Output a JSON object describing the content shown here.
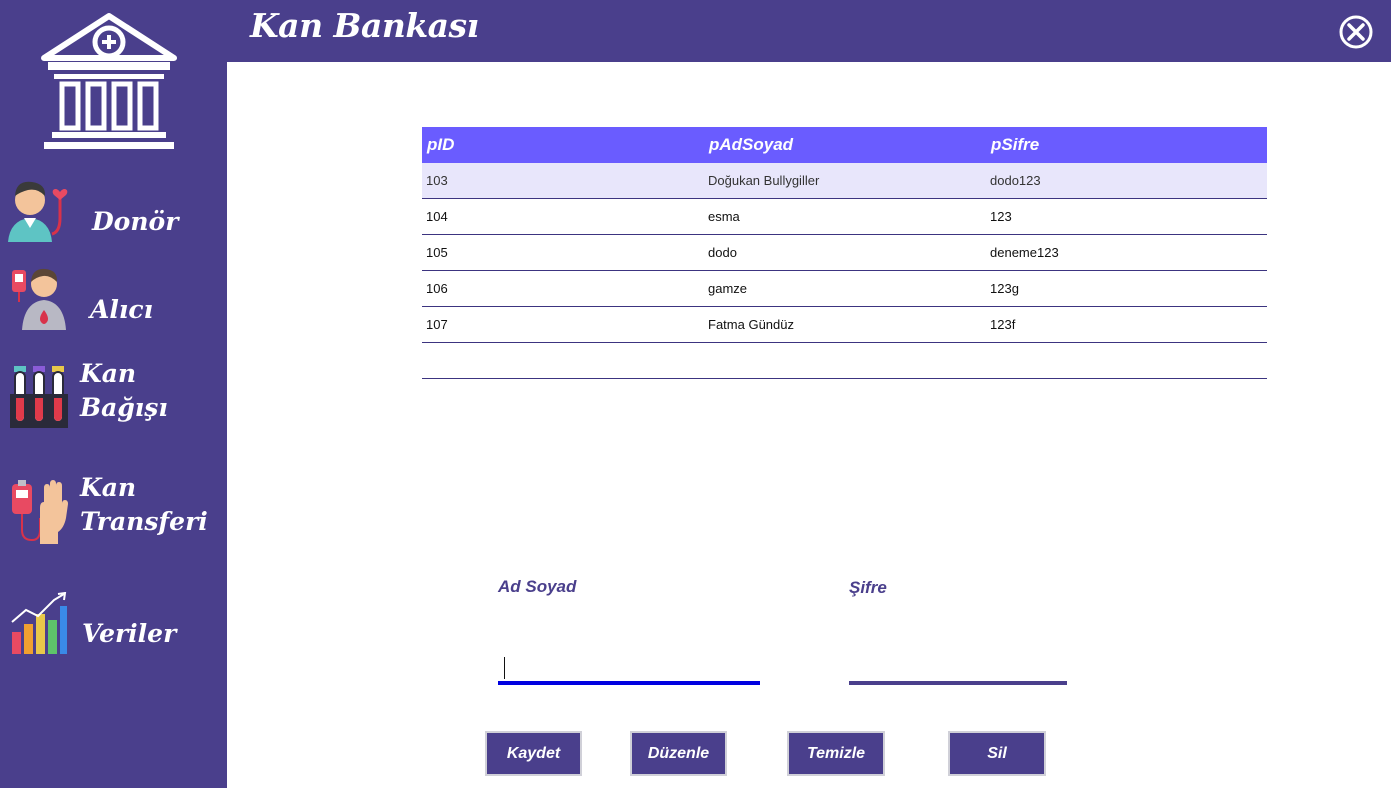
{
  "app": {
    "title": "Kan Bankası"
  },
  "sidebar": {
    "items": [
      {
        "label": "Donör",
        "icon": "donor-icon"
      },
      {
        "label": "Alıcı",
        "icon": "recipient-icon"
      },
      {
        "label_line1": "Kan",
        "label_line2": "Bağışı",
        "icon": "blood-tubes-icon"
      },
      {
        "label_line1": "Kan",
        "label_line2": "Transferi",
        "icon": "blood-transfer-icon"
      },
      {
        "label": "Veriler",
        "icon": "statistics-chart-icon"
      }
    ]
  },
  "grid": {
    "columns": [
      "pID",
      "pAdSoyad",
      "pSifre"
    ],
    "rows": [
      {
        "id": "103",
        "name": "Doğukan Bullygiller",
        "pass": "dodo123"
      },
      {
        "id": "104",
        "name": "esma",
        "pass": "123"
      },
      {
        "id": "105",
        "name": "dodo",
        "pass": "deneme123"
      },
      {
        "id": "106",
        "name": "gamze",
        "pass": "123g"
      },
      {
        "id": "107",
        "name": "Fatma Gündüz",
        "pass": "123f"
      }
    ]
  },
  "form": {
    "name_label": "Ad Soyad",
    "name_value": "",
    "password_label": "Şifre",
    "password_value": ""
  },
  "buttons": {
    "save": "Kaydet",
    "edit": "Düzenle",
    "clear": "Temizle",
    "delete": "Sil"
  },
  "colors": {
    "sidebar": "#4a3f8c",
    "header_row": "#6a5cff",
    "focus_underline": "#0000e0",
    "underline": "#4a3f8c",
    "selected_row": "#e8e6fb"
  }
}
